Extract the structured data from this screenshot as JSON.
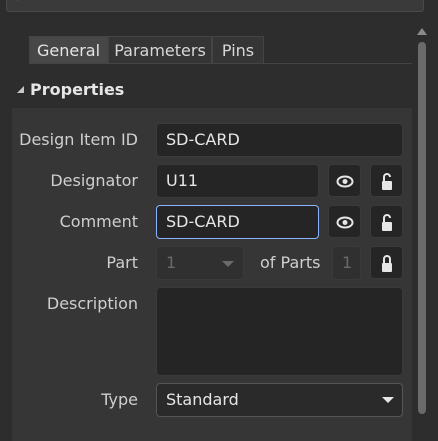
{
  "tabs": [
    {
      "label": "General"
    },
    {
      "label": "Parameters"
    },
    {
      "label": "Pins"
    }
  ],
  "section": {
    "title": "Properties"
  },
  "fields": {
    "design_item_id": {
      "label": "Design Item ID",
      "value": "SD-CARD"
    },
    "designator": {
      "label": "Designator",
      "value": "U11"
    },
    "comment": {
      "label": "Comment",
      "value": "SD-CARD"
    },
    "part": {
      "label": "Part",
      "value": "1",
      "of_parts_label": "of Parts",
      "of_parts_value": "1"
    },
    "description": {
      "label": "Description",
      "value": ""
    },
    "type": {
      "label": "Type",
      "value": "Standard"
    }
  },
  "icons": {
    "visibility": "eye-icon",
    "lock": "lock-icon",
    "search": "search-icon"
  },
  "colors": {
    "background": "#2d2d2d",
    "panel": "#363636",
    "field": "#252525",
    "focus_border": "#8ab4ff"
  }
}
